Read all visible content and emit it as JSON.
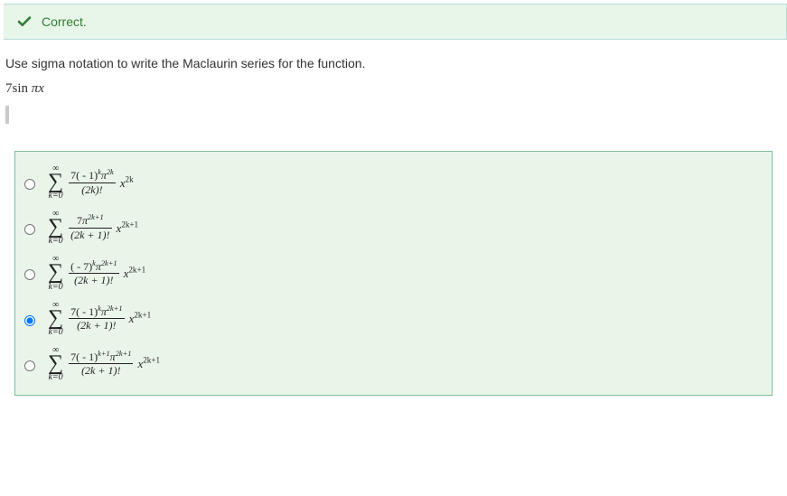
{
  "feedback": {
    "label": "Correct."
  },
  "prompt": "Use sigma notation to write the Maclaurin series for the function.",
  "expression": "7sin πx",
  "sigma": {
    "upper": "∞",
    "symbol": "∑",
    "lower": "k=0"
  },
  "options": [
    {
      "selected": false,
      "numerator": "7( - 1)ᵏπ²ᵏ",
      "num_base": "7( - 1)",
      "num_exp1": "k",
      "num_pi": "π",
      "num_exp2": "2k",
      "denominator": "(2k)!",
      "tail_var": "x",
      "tail_exp": "2k"
    },
    {
      "selected": false,
      "num_base": "7",
      "num_pi": "π",
      "num_exp2": "2k+1",
      "denominator": "(2k + 1)!",
      "tail_var": "x",
      "tail_exp": "2k+1"
    },
    {
      "selected": false,
      "num_base": "( - 7)",
      "num_exp1": "k",
      "num_pi": "π",
      "num_exp2": "2k+1",
      "denominator": "(2k + 1)!",
      "tail_var": "x",
      "tail_exp": "2k+1"
    },
    {
      "selected": true,
      "num_base": "7( - 1)",
      "num_exp1": "k",
      "num_pi": "π",
      "num_exp2": "2k+1",
      "denominator": "(2k + 1)!",
      "tail_var": "x",
      "tail_exp": "2k+1"
    },
    {
      "selected": false,
      "num_base": "7( - 1)",
      "num_exp1": "k+1",
      "num_pi": "π",
      "num_exp2": "2k+1",
      "denominator": "(2k + 1)!",
      "tail_var": "x",
      "tail_exp": "2k+1"
    }
  ]
}
